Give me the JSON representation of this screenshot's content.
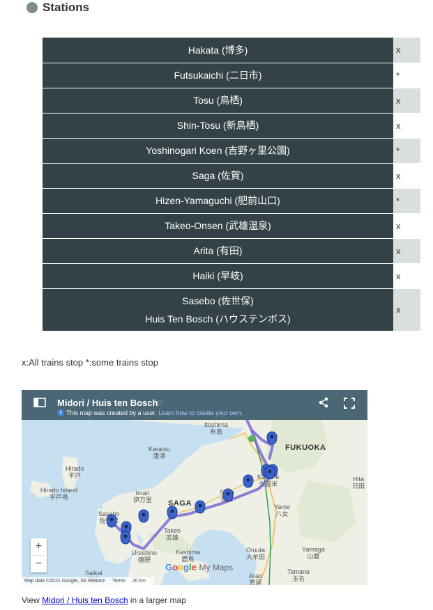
{
  "section": {
    "title": "Stations"
  },
  "stations": [
    {
      "name": "Hakata (博多)",
      "mark": "x"
    },
    {
      "name": "Futsukaichi (二日市)",
      "mark": "*"
    },
    {
      "name": "Tosu (鳥栖)",
      "mark": "x"
    },
    {
      "name": "Shin-Tosu (新鳥栖)",
      "mark": "x"
    },
    {
      "name": "Yoshinogari Koen (吉野ヶ里公園)",
      "mark": "*"
    },
    {
      "name": "Saga (佐賀)",
      "mark": "x"
    },
    {
      "name": "Hizen-Yamaguchi (肥前山口)",
      "mark": "*"
    },
    {
      "name": "Takeo-Onsen (武雄温泉)",
      "mark": "x"
    },
    {
      "name": "Arita (有田)",
      "mark": "x"
    },
    {
      "name": "Haiki (早岐)",
      "mark": "x"
    },
    {
      "name": "Sasebo (佐世保)",
      "name2": "Huis Ten Bosch (ハウステンボス)",
      "mark": "x"
    }
  ],
  "legend": "x:All trains stop *:some trains stop",
  "map": {
    "title": "Midori / Huis ten Bosch",
    "star": "☆",
    "info": "i",
    "note_text": "This map was created by a user. ",
    "note_link": "Learn how to create your own.",
    "zoom_in": "+",
    "zoom_out": "−",
    "logo": {
      "g": "G",
      "o1": "o",
      "o2": "o",
      "g2": "g",
      "l": "l",
      "e": "e",
      "my": "My Maps"
    },
    "attribution": {
      "data": "Map data ©2021 Google, SK telecom",
      "terms": "Terms",
      "scale": "20 km"
    },
    "places": {
      "itoshima": "Itoshima",
      "itoshima_jp": "糸島",
      "fukuoka": "FUKUOKA",
      "karatsu": "Karatsu",
      "karatsu_jp": "唐津",
      "hirado": "Hirado",
      "hirado_jp": "平戸",
      "hirado_island": "Hirado Island",
      "hirado_island_jp": "平戸島",
      "imari": "Imari",
      "imari_jp": "伊万里",
      "saga": "SAGA",
      "kurume": "Kurume",
      "kurume_jp": "久留米",
      "hita": "Hita",
      "hita_jp": "日田",
      "yame": "Yame",
      "yame_jp": "八女",
      "sasebo": "Sasebo",
      "sasebo_jp": "佐世保",
      "takeo": "Takeo",
      "takeo_jp": "武雄",
      "ureshino": "Ureshino",
      "ureshino_jp": "嬉野",
      "kashima": "Kashima",
      "kashima_jp": "鹿島",
      "saikai": "Saikai",
      "saikai_jp": "西海",
      "omuta": "Omuta",
      "omuta_jp": "大牟田",
      "yamaga": "Yamaga",
      "yamaga_jp": "山鹿",
      "arao": "Arao",
      "arao_jp": "荒尾",
      "tamana": "Tamana",
      "tamana_jp": "玉名",
      "saga_small": "Saga",
      "saga_small_jp": "佐賀"
    }
  },
  "footer": {
    "prefix": "View ",
    "link": "Midori / Huis ten Bosch",
    "suffix": " in a larger map"
  }
}
